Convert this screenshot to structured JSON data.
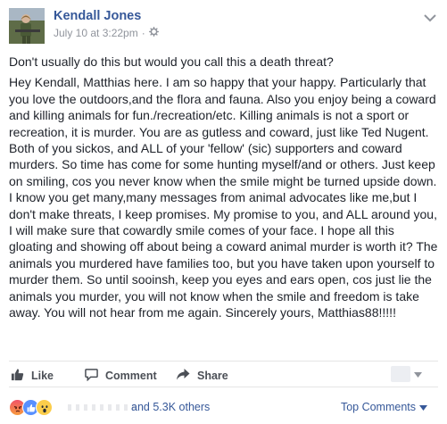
{
  "post": {
    "author": "Kendall Jones",
    "timestamp": "July 10 at 3:22pm",
    "separator": "·",
    "audience_icon": "gear-icon",
    "menu_icon": "chevron-down-icon",
    "intro": "Don't usually do this but would you call this a death threat?",
    "message": "Hey Kendall, Matthias here. I am so happy that your happy. Particularly that you love the outdoors,and the flora and fauna. Also you enjoy being a coward and killing animals for fun./recreation/etc. Killing animals is not a sport or recreation, it is murder. You are as gutless and coward, just like Ted Nugent. Both of you sickos, and ALL of your 'fellow' (sic) supporters and coward murders. So time has come for some hunting myself/and or others. Just keep on smiling, cos you never know when the smile might be turned upside down. I know you get many,many messages from animal advocates like me,but I don't make threats, I keep promises. My promise to you, and ALL around you, I will make sure that cowardly smile comes of your face. I hope all this gloating and showing off about being a coward animal murder is worth it? The animals you murdered have families too, but you have taken upon yourself to murder them. So until sooinsh, keep you eyes and ears open, cos just lie the animals you murder, you will not know when the smile and freedom is take away. You will not hear from me again. Sincerely yours, Matthias88!!!!!"
  },
  "actions": {
    "like": {
      "label": "Like",
      "icon": "thumbs-up-icon"
    },
    "comment": {
      "label": "Comment",
      "icon": "comment-bubble-icon"
    },
    "share": {
      "label": "Share",
      "icon": "share-arrow-icon"
    }
  },
  "reactions": {
    "types": [
      "angry",
      "like",
      "wow"
    ],
    "summary": "and 5.3K others"
  },
  "comments": {
    "filter_label": "Top Comments",
    "filter_icon": "dropdown-caret-icon"
  },
  "colors": {
    "link": "#365899",
    "meta": "#90949c",
    "text": "#1d2129",
    "action": "#4b4f56",
    "divider": "#e5e5e5",
    "like_reaction": "#5890ff",
    "wow_reaction": "#fbcd4b",
    "angry_reaction": "#f15268"
  }
}
